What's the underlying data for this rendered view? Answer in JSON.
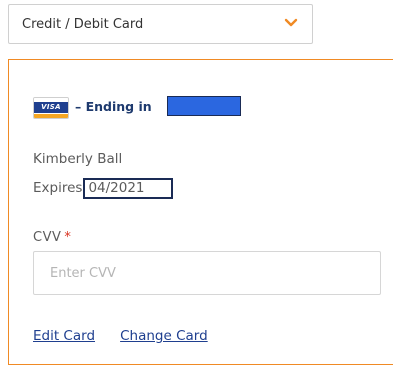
{
  "payment_method": {
    "selected": "Credit / Debit Card",
    "chevron_icon": "chevron-down-icon",
    "accent_color": "#f08a24"
  },
  "card": {
    "brand": "VISA",
    "brand_icon": "visa-card-icon",
    "ending_label": "– Ending in",
    "holder_name": "Kimberly Ball",
    "expires_label": "Expires",
    "expiry": "04/2021"
  },
  "cvv": {
    "label": "CVV",
    "required_marker": "*",
    "placeholder": "Enter CVV",
    "value": ""
  },
  "actions": {
    "edit_card": "Edit Card",
    "change_card": "Change Card"
  }
}
